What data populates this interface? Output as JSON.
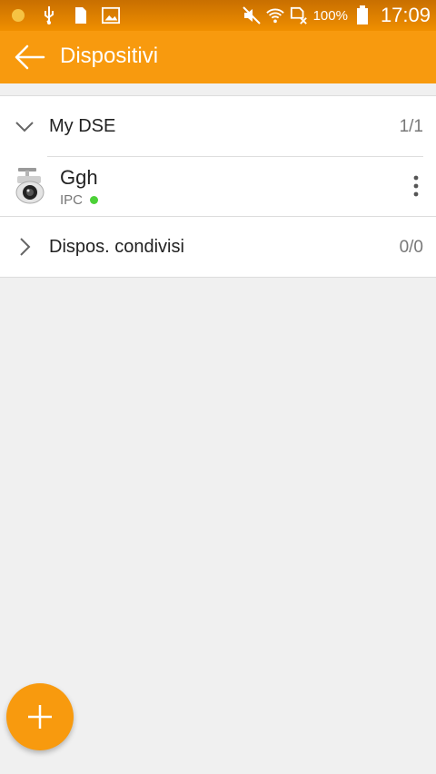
{
  "status_bar": {
    "icons": [
      "notification-dot-icon",
      "usb-icon",
      "sd-card-icon",
      "image-icon",
      "mute-icon",
      "wifi-icon",
      "no-sim-icon",
      "battery-icon"
    ],
    "battery_percent": "100%",
    "time": "17:09"
  },
  "app_bar": {
    "title": "Dispositivi",
    "back_icon": "arrow-left-icon",
    "color": "#f89a0e"
  },
  "groups": [
    {
      "label": "My DSE",
      "count": "1/1",
      "expanded": true,
      "devices": [
        {
          "name": "Ggh",
          "type": "IPC",
          "status": "online",
          "status_color": "#4cd137",
          "icon": "security-camera-icon"
        }
      ]
    },
    {
      "label": "Dispos. condivisi",
      "count": "0/0",
      "expanded": false,
      "devices": []
    }
  ],
  "fab": {
    "icon": "plus-icon"
  }
}
